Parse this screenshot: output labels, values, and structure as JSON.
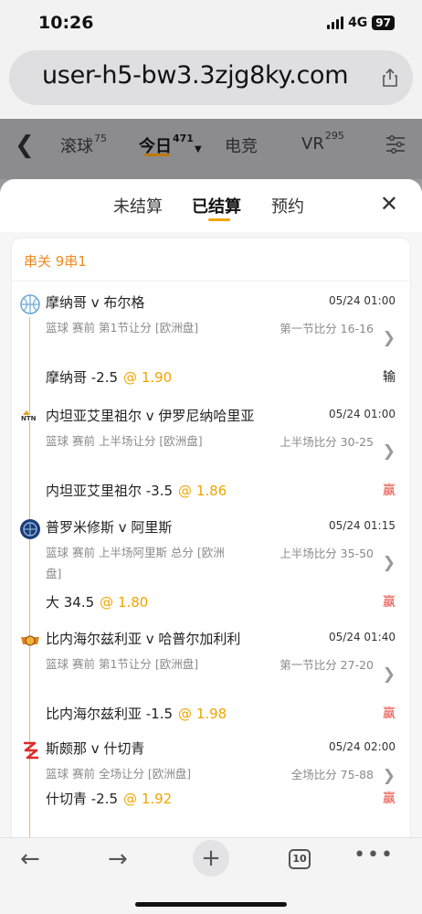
{
  "status": {
    "time": "10:26",
    "network": "4G",
    "battery": "97"
  },
  "browser": {
    "url": "user-h5-bw3.3zjg8ky.com",
    "tab_count": "10"
  },
  "nav": {
    "tabs": [
      {
        "label": "滚球",
        "count": "75"
      },
      {
        "label": "今日",
        "count": "471"
      },
      {
        "label": "电竞",
        "count": ""
      },
      {
        "label": "VR",
        "count": "295"
      }
    ]
  },
  "sheet": {
    "tabs": [
      "未结算",
      "已结算",
      "预约"
    ],
    "active_tab": "已结算",
    "close": "✕"
  },
  "parlay": {
    "title": "串关 9串1",
    "bets": [
      {
        "logo": "basketball-icon",
        "match": "摩纳哥 v 布尔格",
        "datetime": "05/24 01:00",
        "meta": "篮球  赛前  第1节让分 [欧洲盘]",
        "meta2": "",
        "score": "第一节比分 16-16",
        "pick": "摩纳哥 -2.5",
        "odds": "@ 1.90",
        "result": "输",
        "result_color": "#222222"
      },
      {
        "logo": "team-logo-icon",
        "match": "内坦亚艾里祖尔 v 伊罗尼纳哈里亚",
        "datetime": "05/24 01:00",
        "meta": "篮球  赛前  上半场让分 [欧洲盘]",
        "meta2": "",
        "score": "上半场比分 30-25",
        "pick": "内坦亚艾里祖尔 -3.5",
        "odds": "@ 1.86",
        "result": "赢",
        "result_color": "#e8463a"
      },
      {
        "logo": "ball-globe-icon",
        "match": "普罗米修斯 v 阿里斯",
        "datetime": "05/24 01:15",
        "meta": "篮球  赛前  上半场阿里斯 总分 [欧洲",
        "meta2": "盘]",
        "score": "上半场比分 35-50",
        "pick": "大 34.5",
        "odds": "@ 1.80",
        "result": "赢",
        "result_color": "#e8463a"
      },
      {
        "logo": "team-crest-icon",
        "match": "比内海尔兹利亚 v 哈普尔加利利",
        "datetime": "05/24 01:40",
        "meta": "篮球  赛前  第1节让分 [欧洲盘]",
        "meta2": "",
        "score": "第一节比分 27-20",
        "pick": "比内海尔兹利亚 -1.5",
        "odds": "@ 1.98",
        "result": "赢",
        "result_color": "#e8463a"
      },
      {
        "logo": "red-squiggle-icon",
        "match": "斯颇那 v 什切青",
        "datetime": "05/24 02:00",
        "meta": "篮球  赛前  全场让分 [欧洲盘]",
        "meta2": "",
        "score": "全场比分 75-88",
        "pick": "什切青 -2.5",
        "odds": "@ 1.92",
        "result": "赢",
        "result_color": "#e8463a"
      }
    ]
  },
  "colors": {
    "accent": "#f0a500",
    "title_orange": "#f08a24",
    "win_red": "#e8463a"
  }
}
